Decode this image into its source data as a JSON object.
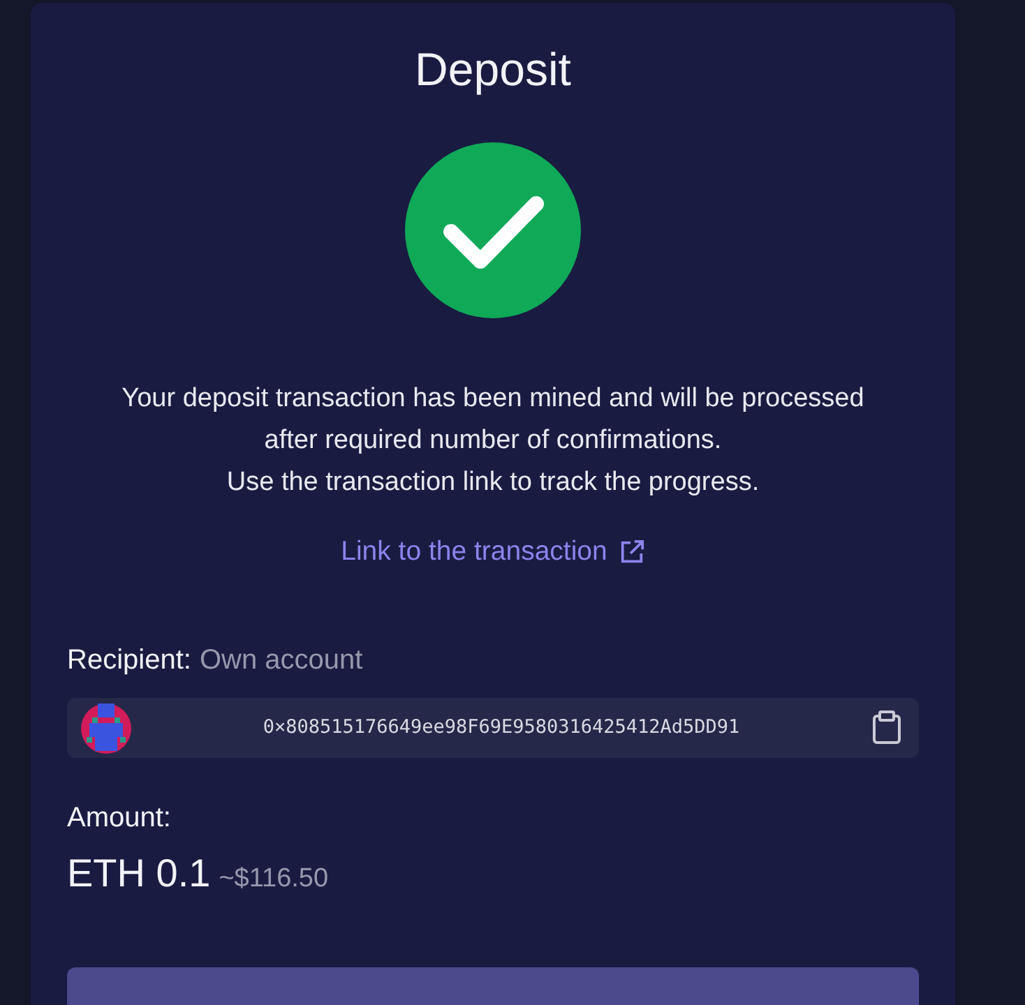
{
  "title": "Deposit",
  "status": {
    "kind": "success"
  },
  "message_lines": [
    "Your deposit transaction has been mined and will be processed",
    "after required number of confirmations.",
    "Use the transaction link to track the progress."
  ],
  "link": {
    "label": "Link to the transaction"
  },
  "recipient": {
    "label": "Recipient:",
    "value": "Own account",
    "address": "0×808515176649ee98F69E9580316425412Ad5DD91"
  },
  "amount": {
    "label": "Amount:",
    "value": "ETH 0.1",
    "fiat": "~$116.50"
  },
  "primary_button": {
    "visible": true
  }
}
